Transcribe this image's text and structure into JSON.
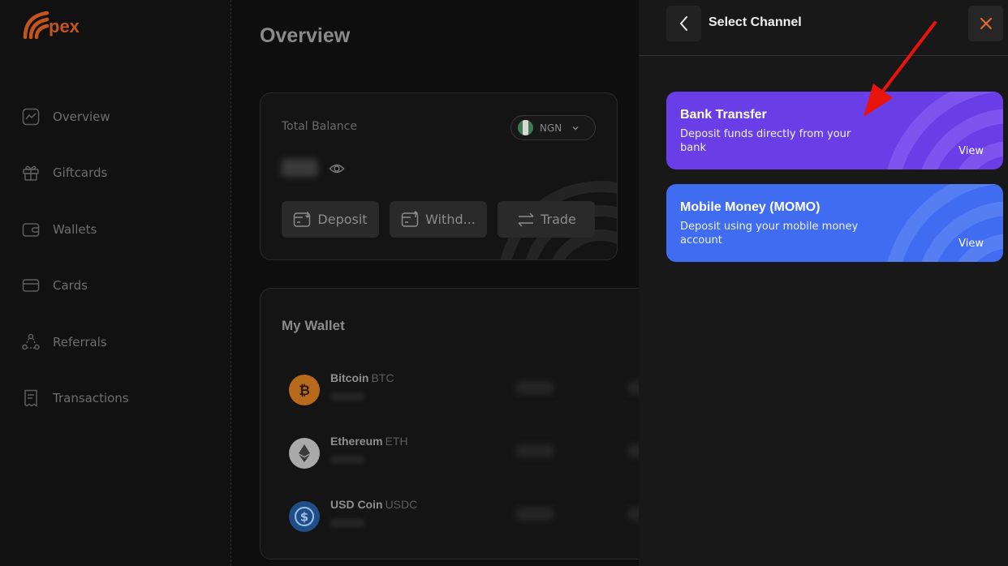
{
  "app": {
    "logo_text": "pex"
  },
  "sidebar": {
    "items": [
      {
        "label": "Overview",
        "icon": "chart-line-icon"
      },
      {
        "label": "Giftcards",
        "icon": "gift-icon"
      },
      {
        "label": "Wallets",
        "icon": "wallet-icon"
      },
      {
        "label": "Cards",
        "icon": "card-icon"
      },
      {
        "label": "Referrals",
        "icon": "referrals-icon"
      },
      {
        "label": "Transactions",
        "icon": "receipt-icon"
      }
    ]
  },
  "main": {
    "title": "Overview",
    "balance": {
      "label": "Total Balance",
      "currency": "NGN",
      "actions": [
        "Deposit",
        "Withd...",
        "Trade"
      ]
    },
    "wallet": {
      "title": "My Wallet",
      "coins": [
        {
          "name": "Bitcoin",
          "symbol": "BTC",
          "color": "#f7931a"
        },
        {
          "name": "Ethereum",
          "symbol": "ETH",
          "color": "#d9d9d9"
        },
        {
          "name": "USD Coin",
          "symbol": "USDC",
          "color": "#2775ca"
        }
      ]
    }
  },
  "panel": {
    "title": "Select Channel",
    "channels": [
      {
        "title": "Bank Transfer",
        "description": "Deposit funds directly from your bank",
        "action": "View",
        "color": "#6a3ee6"
      },
      {
        "title": "Mobile Money (MOMO)",
        "description": "Deposit using your mobile money account",
        "action": "View",
        "color": "#3f6cf0"
      }
    ]
  },
  "colors": {
    "brand": "#c2551e",
    "close": "#e06a2a",
    "annotation_arrow": "#e8140c"
  }
}
